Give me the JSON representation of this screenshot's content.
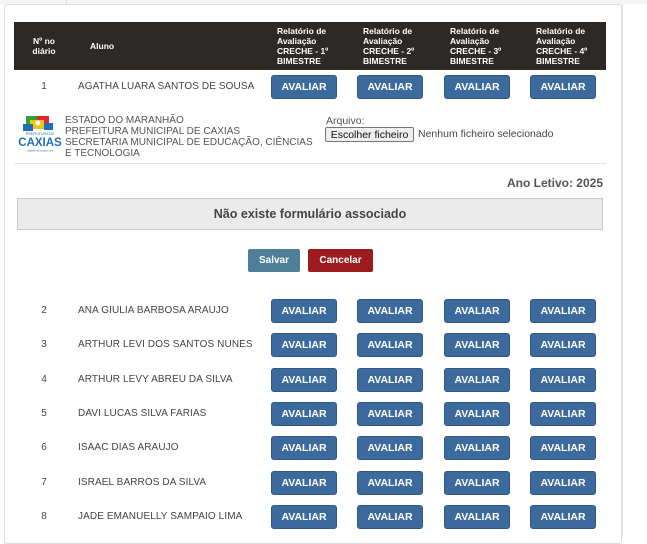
{
  "table": {
    "headers": {
      "num": "Nº no diário",
      "aluno": "Aluno",
      "relatorios": [
        "Relatório de Avaliação CRECHE - 1º BIMESTRE",
        "Relatório de Avaliação CRECHE - 2º BIMESTRE",
        "Relatório de Avaliação CRECHE - 3º BIMESTRE",
        "Relatório de Avaliação CRECHE - 4º BIMESTRE"
      ]
    },
    "avaliar_label": "AVALIAR",
    "rows": [
      {
        "num": "1",
        "name": "AGATHA LUARA SANTOS DE SOUSA"
      },
      {
        "num": "2",
        "name": "ANA GIULIA BARBOSA ARAUJO"
      },
      {
        "num": "3",
        "name": "ARTHUR LEVI DOS SANTOS NUNES"
      },
      {
        "num": "4",
        "name": "ARTHUR LEVY ABREU DA SILVA"
      },
      {
        "num": "5",
        "name": "DAVI LUCAS SILVA FARIAS"
      },
      {
        "num": "6",
        "name": "ISAAC DIAS ARAUJO"
      },
      {
        "num": "7",
        "name": "ISRAEL BARROS DA SILVA"
      },
      {
        "num": "8",
        "name": "JADE EMANUELLY SAMPAIO LIMA"
      }
    ]
  },
  "form": {
    "logo_top": "PREFEITURA DE",
    "logo_main": "CAXIAS",
    "logo_sub": "cidade de todos nós",
    "org_lines": [
      "ESTADO DO MARANHÃO",
      "PREFEITURA MUNICIPAL DE CAXIAS",
      "SECRETARIA MUNICIPAL DE EDUCAÇÃO, CIÊNCIAS",
      "E TECNOLOGIA"
    ],
    "file_label": "Arquivo:",
    "file_button": "Escolher ficheiro",
    "file_status": "Nenhum ficheiro selecionado",
    "ano_letivo": "Ano Letivo: 2025",
    "no_form_message": "Não existe formulário associado",
    "save_label": "Salvar",
    "cancel_label": "Cancelar"
  },
  "colors": {
    "header_bg": "#2d2926",
    "avaliar_btn": "#3d6a9c",
    "save_btn": "#4f7f98",
    "cancel_btn": "#9b1b1f"
  }
}
